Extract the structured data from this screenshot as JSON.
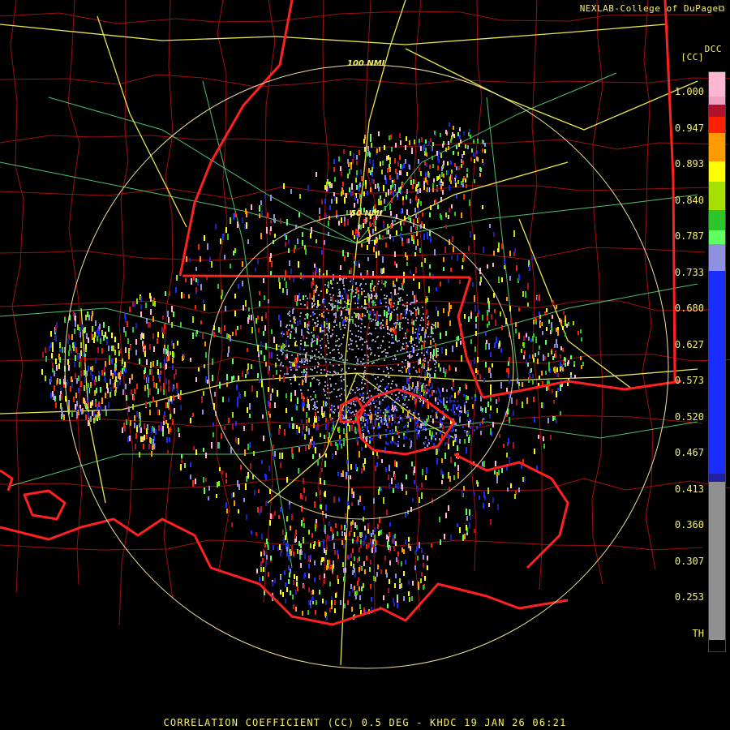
{
  "header": {
    "credit": "NEXLAB-College of DuPage",
    "credit_icon": "external-link-icon",
    "product_code": "DCC",
    "product_unit": "[CC]"
  },
  "footer": {
    "caption": "CORRELATION COEFFICIENT (CC) 0.5 DEG - KHDC 19 JAN 26 06:21"
  },
  "range_rings": [
    {
      "label": "100 NMI"
    },
    {
      "label": "50 NMI"
    }
  ],
  "legend": {
    "labels": [
      "1.000",
      "0.947",
      "0.893",
      "0.840",
      "0.787",
      "0.733",
      "0.680",
      "0.627",
      "0.573",
      "0.520",
      "0.467",
      "0.413",
      "0.360",
      "0.307",
      "0.253",
      "TH"
    ],
    "colors": {
      "pink": "#ffb6d3",
      "light_pink": "#f2a0bf",
      "dark_red": "#b0102a",
      "red": "#ff2000",
      "orange": "#ff9a00",
      "yellow": "#ffff00",
      "lime": "#a6e000",
      "green": "#2cc62c",
      "light_green": "#60ff60",
      "lavender": "#9090e0",
      "blue": "#1a2cff",
      "navy": "#1e22a0",
      "gray": "#909090",
      "black": "#000000"
    }
  },
  "map_colors": {
    "background": "#000000",
    "county_lines": "#a01010",
    "state_lines": "#ff2020",
    "highways": "#e8e850",
    "roads": "#50c070",
    "rings": "#f0e0a0"
  }
}
